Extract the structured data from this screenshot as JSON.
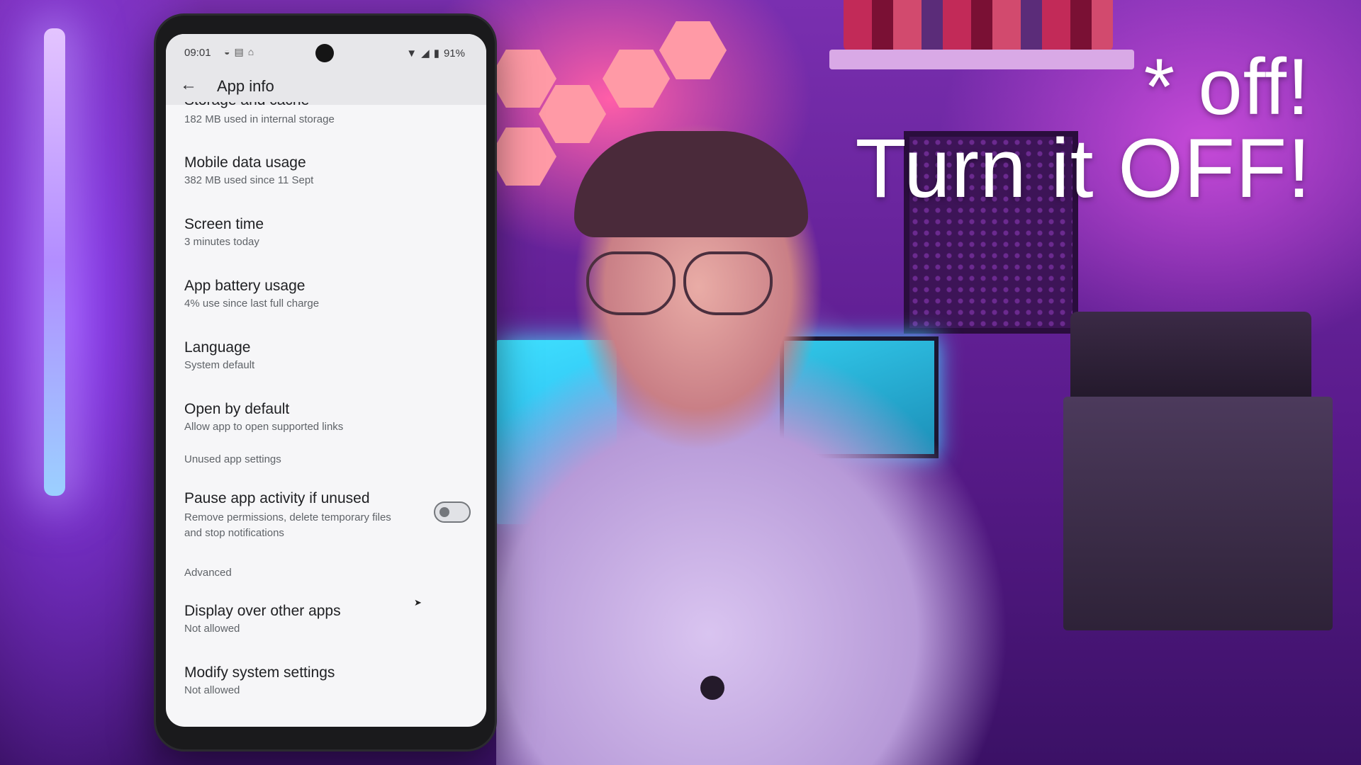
{
  "status_bar": {
    "time": "09:01",
    "battery": "91%",
    "left_icons": [
      "shield-icon",
      "message-icon",
      "home-icon"
    ],
    "right_icons": [
      "wifi-icon",
      "signal-icon",
      "battery-icon"
    ]
  },
  "app_bar": {
    "title": "App info"
  },
  "clipped_item": {
    "title": "Storage and cache",
    "subtitle": "182 MB used in internal storage"
  },
  "items": [
    {
      "title": "Mobile data usage",
      "subtitle": "382 MB used since 11 Sept"
    },
    {
      "title": "Screen time",
      "subtitle": "3 minutes today"
    },
    {
      "title": "App battery usage",
      "subtitle": "4% use since last full charge"
    },
    {
      "title": "Language",
      "subtitle": "System default"
    },
    {
      "title": "Open by default",
      "subtitle": "Allow app to open supported links"
    }
  ],
  "sections": {
    "unused": "Unused app settings",
    "advanced": "Advanced"
  },
  "pause_setting": {
    "title": "Pause app activity if unused",
    "subtitle": "Remove permissions, delete temporary files and stop notifications",
    "enabled": false
  },
  "advanced_items": [
    {
      "title": "Display over other apps",
      "subtitle": "Not allowed"
    },
    {
      "title": "Modify system settings",
      "subtitle": "Not allowed"
    }
  ],
  "overlay": {
    "line1": "* off!",
    "line2": "Turn it OFF!"
  }
}
